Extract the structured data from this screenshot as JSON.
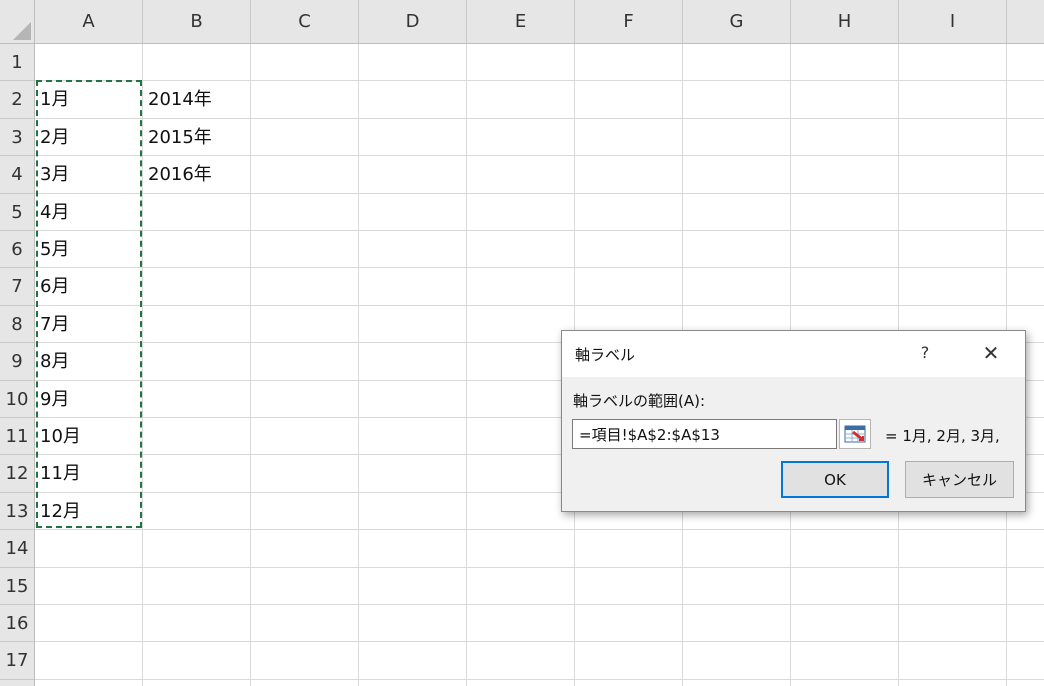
{
  "columns": [
    "A",
    "B",
    "C",
    "D",
    "E",
    "F",
    "G",
    "H",
    "I"
  ],
  "rows": [
    "1",
    "2",
    "3",
    "4",
    "5",
    "6",
    "7",
    "8",
    "9",
    "10",
    "11",
    "12",
    "13",
    "14",
    "15",
    "16",
    "17"
  ],
  "cells": {
    "A2": "1月",
    "A3": "2月",
    "A4": "3月",
    "A5": "4月",
    "A6": "5月",
    "A7": "6月",
    "A8": "7月",
    "A9": "8月",
    "A10": "9月",
    "A11": "10月",
    "A12": "11月",
    "A13": "12月",
    "B2": "2014年",
    "B3": "2015年",
    "B4": "2016年"
  },
  "selection": {
    "range": "A2:A13",
    "color": "#217346"
  },
  "dialog": {
    "title": "軸ラベル",
    "help": "?",
    "close": "✕",
    "range_label": "軸ラベルの範囲(A):",
    "range_value": "=項目!$A$2:$A$13",
    "preview": "= 1月, 2月, 3月,",
    "ok": "OK",
    "cancel": "キャンセル",
    "collapse_icon": "range-select-icon"
  },
  "colors": {
    "header_bg": "#e6e6e6",
    "grid": "#d9d9d9",
    "focus": "#0078d7"
  }
}
